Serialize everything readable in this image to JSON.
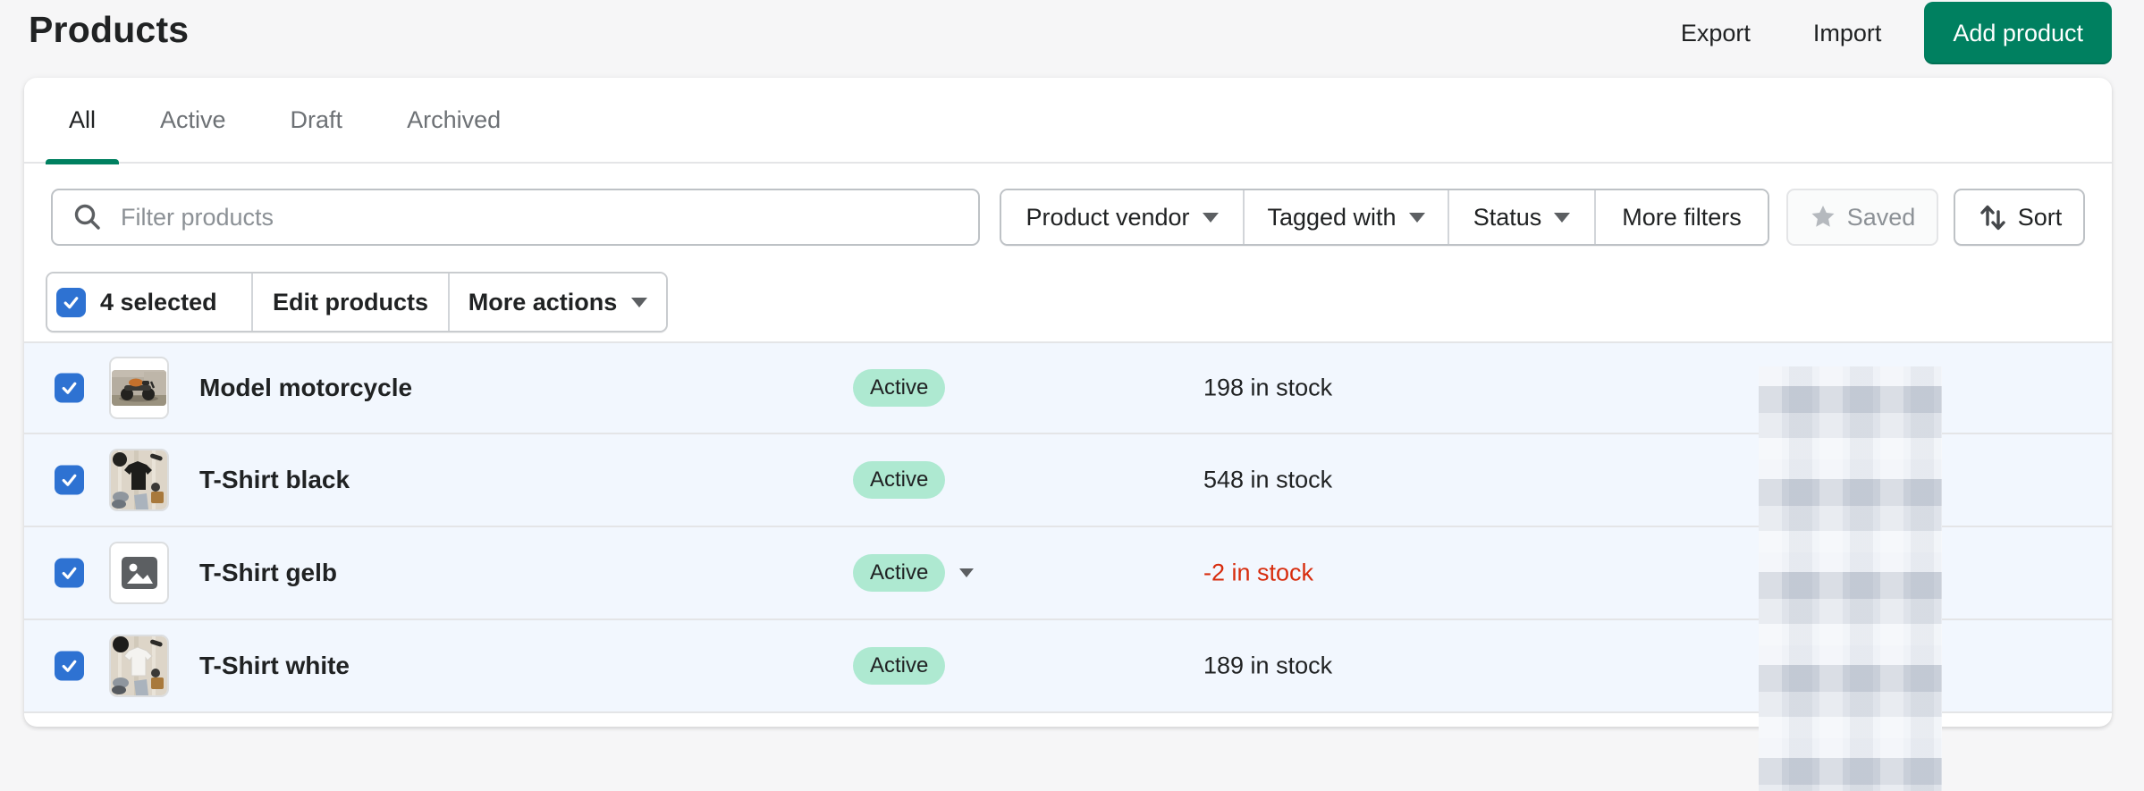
{
  "page": {
    "title": "Products"
  },
  "header_actions": {
    "export": "Export",
    "import": "Import",
    "add_product": "Add product"
  },
  "tabs": [
    {
      "label": "All",
      "active": true
    },
    {
      "label": "Active",
      "active": false
    },
    {
      "label": "Draft",
      "active": false
    },
    {
      "label": "Archived",
      "active": false
    }
  ],
  "filter_bar": {
    "search_placeholder": "Filter products",
    "product_vendor": "Product vendor",
    "tagged_with": "Tagged with",
    "status": "Status",
    "more_filters": "More filters",
    "saved": "Saved",
    "sort": "Sort"
  },
  "bulk_actions": {
    "selected_count": "4 selected",
    "edit_products": "Edit products",
    "more_actions": "More actions"
  },
  "products": [
    {
      "name": "Model motorcycle",
      "status": "Active",
      "inventory": "198 in stock",
      "selected": true,
      "thumbnail": "motorcycle-photo"
    },
    {
      "name": "T-Shirt black",
      "status": "Active",
      "inventory": "548 in stock",
      "selected": true,
      "thumbnail": "black-tshirt-photo"
    },
    {
      "name": "T-Shirt gelb",
      "status": "Active",
      "inventory": "-2 in stock",
      "inventory_negative": true,
      "status_has_caret": true,
      "selected": true,
      "thumbnail": "image-placeholder-icon"
    },
    {
      "name": "T-Shirt white",
      "status": "Active",
      "inventory": "189 in stock",
      "selected": true,
      "thumbnail": "white-tshirt-photo"
    }
  ],
  "redacted_column": {
    "present": true,
    "style": "pixelated-blur"
  },
  "colors": {
    "brand_green": "#008060",
    "checkbox_blue": "#2E72D2",
    "badge_success_bg": "#AEE9D1",
    "critical_text": "#D72C0D",
    "selected_row_bg": "#F2F7FE",
    "page_bg": "#F6F6F7"
  }
}
